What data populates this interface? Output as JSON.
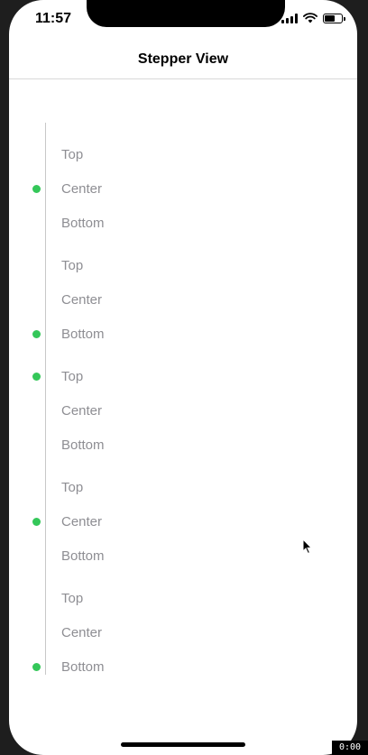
{
  "status": {
    "time": "11:57"
  },
  "navbar": {
    "title": "Stepper View"
  },
  "colors": {
    "accent": "#34c759",
    "label": "#8e8e93",
    "line": "#c8c8c8"
  },
  "groups": [
    {
      "items": [
        "Top",
        "Center",
        "Bottom"
      ],
      "active": "Center"
    },
    {
      "items": [
        "Top",
        "Center",
        "Bottom"
      ],
      "active": "Bottom"
    },
    {
      "items": [
        "Top",
        "Center",
        "Bottom"
      ],
      "active": "Top"
    },
    {
      "items": [
        "Top",
        "Center",
        "Bottom"
      ],
      "active": "Center"
    },
    {
      "items": [
        "Top",
        "Center",
        "Bottom"
      ],
      "active": "Bottom"
    }
  ],
  "badge": "0:00"
}
